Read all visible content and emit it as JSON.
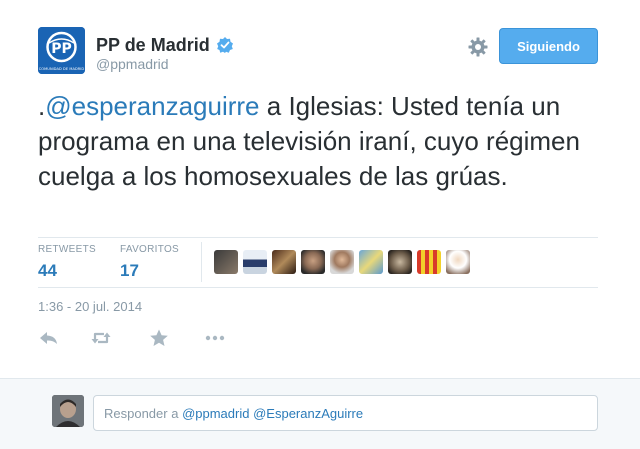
{
  "user": {
    "name": "PP de Madrid",
    "handle": "@ppmadrid",
    "logo_text": "PP",
    "logo_caption": "COMUNIDAD DE MADRID"
  },
  "follow_button": {
    "label": "Siguiendo"
  },
  "tweet": {
    "prefix": ".",
    "mention": "@esperanzaguirre",
    "text": " a Iglesias: Usted tenía un programa en una televisión iraní, cuyo régimen cuelga a los homosexuales de las grúas."
  },
  "stats": {
    "retweets_label": "RETWEETS",
    "retweets_value": "44",
    "favorites_label": "FAVORITOS",
    "favorites_value": "17"
  },
  "favoriters": [
    "avatar-1",
    "avatar-2",
    "avatar-3",
    "avatar-4",
    "avatar-5",
    "avatar-6",
    "avatar-7",
    "avatar-8",
    "avatar-9"
  ],
  "timestamp": "1:36 - 20 jul. 2014",
  "actions": {
    "reply": "reply-icon",
    "retweet": "retweet-icon",
    "favorite": "star-icon",
    "more": "more-icon"
  },
  "reply_box": {
    "prefix": "Responder a ",
    "mention1": "@ppmadrid",
    "mention2": "@EsperanzAguirre"
  },
  "colors": {
    "link": "#2b7bb9",
    "button": "#55acee",
    "muted": "#8899a6",
    "brand_blue": "#1a64b4"
  }
}
